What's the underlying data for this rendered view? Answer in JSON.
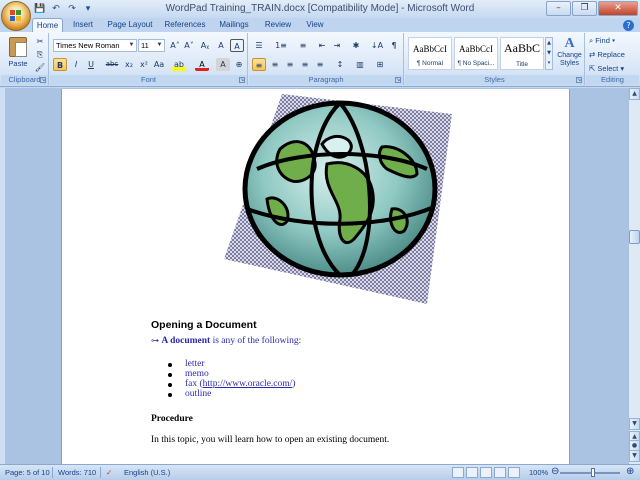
{
  "window": {
    "title": "WordPad Training_TRAIN.docx [Compatibility Mode] - Microsoft Word",
    "controls": {
      "minimize": "–",
      "restore": "❐",
      "close": "✕"
    }
  },
  "quick_access": {
    "save": "💾",
    "undo": "↶",
    "redo": "↷",
    "customize": "▾"
  },
  "tabs": [
    "Home",
    "Insert",
    "Page Layout",
    "References",
    "Mailings",
    "Review",
    "View"
  ],
  "help": "?",
  "ribbon": {
    "clipboard": {
      "label": "Clipboard",
      "paste": "Paste",
      "cut": "✂",
      "copy": "⎘",
      "format_painter": "🖌"
    },
    "font": {
      "label": "Font",
      "name": "Times New Roman",
      "size": "11",
      "grow": "A˄",
      "shrink": "A˅",
      "clear": "Aᵪ",
      "phonetic": "A",
      "bold": "B",
      "italic": "I",
      "underline": "U",
      "strike": "abc",
      "subscript": "x₂",
      "superscript": "x²",
      "change_case": "Aa",
      "highlight": "ab",
      "color": "A",
      "enclose": "A",
      "char_border": "⊕"
    },
    "paragraph": {
      "label": "Paragraph",
      "bullets": "☰",
      "numbering": "1≡",
      "multilevel": "≡",
      "decrease_indent": "⇤",
      "increase_indent": "⇥",
      "chinese_layout": "✱",
      "sort": "↓A",
      "show_marks": "¶",
      "align_left": "≡",
      "center": "≡",
      "align_right": "≡",
      "justify": "≡",
      "distribute": "≡",
      "line_spacing": "↕",
      "shading": "▥",
      "borders": "⊞"
    },
    "styles": {
      "label": "Styles",
      "items": [
        {
          "sample": "AaBbCcI",
          "name": "¶ Normal"
        },
        {
          "sample": "AaBbCcI",
          "name": "¶ No Spaci..."
        },
        {
          "sample": "AaBbC",
          "name": "Title"
        }
      ],
      "change_styles": "Change Styles"
    },
    "editing": {
      "label": "Editing",
      "find": "Find",
      "replace": "Replace",
      "select": "Select"
    }
  },
  "document": {
    "heading": "Opening a Document",
    "definition_term": "A document",
    "definition_rest": " is any of the following:",
    "list": [
      "letter",
      "memo",
      "fax (",
      "outline"
    ],
    "fax_link": "http://www.oracle.com/",
    "fax_close": ")",
    "procedure": "Procedure",
    "body": "In this topic, you will learn how to open an existing document."
  },
  "status": {
    "page": "Page: 5 of 10",
    "words": "Words: 710",
    "language": "English (U.S.)",
    "zoom": "100%",
    "zoom_level": 1.0
  }
}
